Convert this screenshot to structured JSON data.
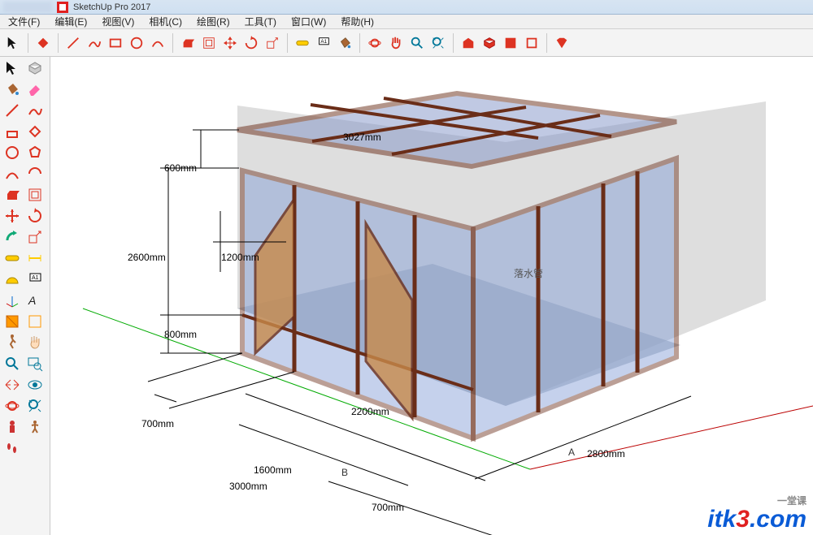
{
  "title_bar": {
    "title": "SketchUp Pro 2017"
  },
  "menu": {
    "file": "文件(F)",
    "edit": "编辑(E)",
    "view": "视图(V)",
    "camera": "相机(C)",
    "draw": "绘图(R)",
    "tools": "工具(T)",
    "window": "窗口(W)",
    "help": "帮助(H)"
  },
  "htoolbar": {
    "icons": [
      "select",
      "paint",
      "eraser",
      "line",
      "freehand",
      "rectangle",
      "circle",
      "arc",
      "push",
      "offset",
      "move",
      "rotate",
      "scale",
      "tape",
      "text",
      "rotate3d",
      "pan",
      "orbit",
      "zoom",
      "zoom-ext",
      "box1",
      "box2",
      "box3",
      "ruby"
    ]
  },
  "left_rail": {
    "icons": [
      "select",
      "box",
      "paint-bucket",
      "eraser",
      "pencil",
      "freehand",
      "line",
      "rectangle",
      "circle",
      "polygon",
      "arc",
      "arc2",
      "push",
      "offset",
      "rotate3d",
      "follow",
      "scale",
      "resize",
      "tape",
      "protractor",
      "text",
      "axes",
      "section",
      "section2",
      "walk",
      "hand",
      "zoom",
      "zoom-window",
      "target",
      "orbit",
      "man",
      "poser",
      "footprints"
    ]
  },
  "viewport": {
    "dimensions": {
      "d3027": "3027mm",
      "d600": "600mm",
      "d2600": "2600mm",
      "d1200": "1200mm",
      "d800": "800mm",
      "d2200": "2200mm",
      "d700a": "700mm",
      "d700b": "700mm",
      "d1600": "1600mm",
      "d3000": "3000mm",
      "d2800": "2800mm"
    },
    "annotations": {
      "downpipe": "落水管",
      "markerA": "A",
      "markerB": "B"
    },
    "watermark": {
      "brand_left": "itk",
      "brand_mid": "3",
      "brand_right": ".com",
      "tag": "一堂课"
    }
  }
}
